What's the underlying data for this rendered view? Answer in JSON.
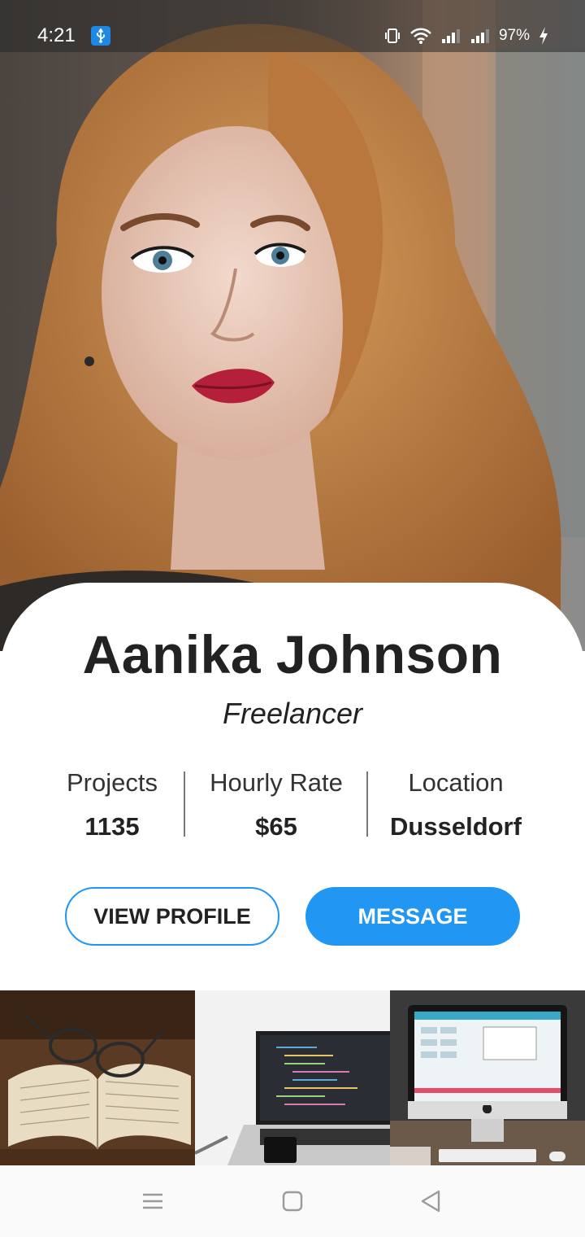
{
  "status_bar": {
    "time": "4:21",
    "battery": "97%",
    "icons": [
      "usb-icon",
      "vibrate-icon",
      "wifi-icon",
      "signal-icon",
      "signal-icon",
      "charging-icon"
    ]
  },
  "profile": {
    "name": "Aanika Johnson",
    "role": "Freelancer"
  },
  "stats": [
    {
      "label": "Projects",
      "value": "1135"
    },
    {
      "label": "Hourly Rate",
      "value": "$65"
    },
    {
      "label": "Location",
      "value": "Dusseldorf"
    }
  ],
  "buttons": {
    "view_profile": "VIEW PROFILE",
    "message": "MESSAGE"
  },
  "gallery": [
    "book-with-glasses-photo",
    "laptop-code-photo",
    "desktop-monitor-photo"
  ],
  "nav": [
    "menu-icon",
    "home-icon",
    "back-icon"
  ],
  "colors": {
    "accent": "#2196f3",
    "text": "#222222"
  }
}
